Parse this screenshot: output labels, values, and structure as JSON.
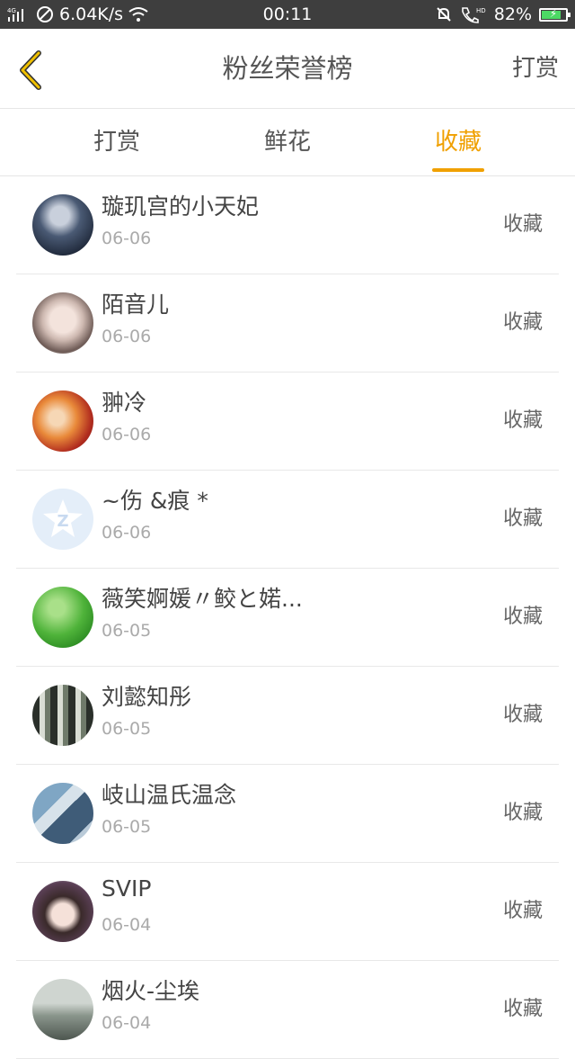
{
  "status_bar": {
    "network": "4G",
    "speed": "6.04K/s",
    "time": "00:11",
    "battery": "82%",
    "battery_fraction": 0.82
  },
  "header": {
    "title": "粉丝荣誉榜",
    "action": "打赏"
  },
  "tabs": [
    {
      "label": "打赏",
      "active": false
    },
    {
      "label": "鲜花",
      "active": false
    },
    {
      "label": "收藏",
      "active": true
    }
  ],
  "colors": {
    "accent": "#f0a000",
    "status_bar_bg": "#3e3e3e"
  },
  "list": [
    {
      "name": "璇玑宫的小天妃",
      "date": "06-06",
      "type": "收藏",
      "avatar": "dark-blue-portrait"
    },
    {
      "name": "陌音儿",
      "date": "06-06",
      "type": "收藏",
      "avatar": "girl-portrait"
    },
    {
      "name": "翀冷",
      "date": "06-06",
      "type": "收藏",
      "avatar": "anime-pair"
    },
    {
      "name": "~伤 &痕 *",
      "date": "06-06",
      "type": "收藏",
      "avatar": "default-star"
    },
    {
      "name": "薇笑婀媛〃鲛と婼...",
      "date": "06-05",
      "type": "收藏",
      "avatar": "green-bokeh"
    },
    {
      "name": "刘懿知彤",
      "date": "06-05",
      "type": "收藏",
      "avatar": "penguins"
    },
    {
      "name": "岐山温氏温念",
      "date": "06-05",
      "type": "收藏",
      "avatar": "blue-collage"
    },
    {
      "name": "SVIP",
      "date": "06-04",
      "type": "收藏",
      "avatar": "girl-headphones"
    },
    {
      "name": "烟火-尘埃",
      "date": "06-04",
      "type": "收藏",
      "avatar": "gray-scene"
    }
  ]
}
